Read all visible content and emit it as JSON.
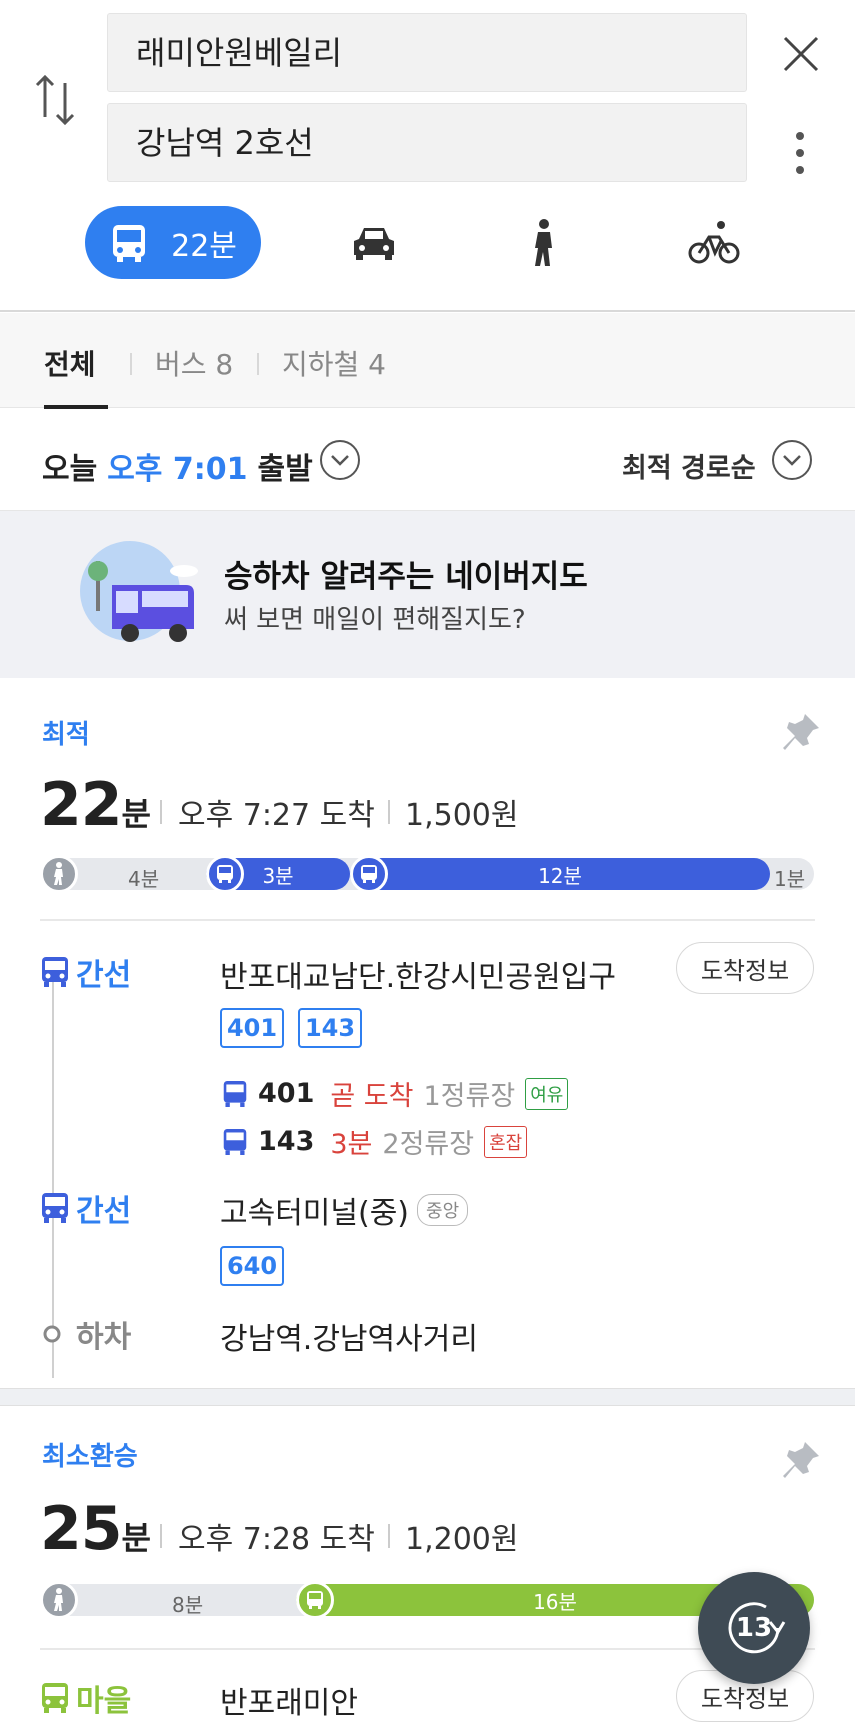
{
  "search": {
    "origin": "래미안원베일리",
    "destination": "강남역 2호선"
  },
  "modes": {
    "transit_time": "22분"
  },
  "tabs": [
    {
      "label": "전체"
    },
    {
      "label": "버스 8"
    },
    {
      "label": "지하철 4"
    }
  ],
  "departure": {
    "prefix": "오늘",
    "time": "오후 7:01",
    "suffix": "출발",
    "sort": "최적 경로순"
  },
  "banner": {
    "title": "승하차 알려주는 네이버지도",
    "subtitle": "써 보면 매일이 편해질지도?"
  },
  "route1": {
    "label": "최적",
    "minutes": "22",
    "minutes_unit": "분",
    "arrival": "오후 7:27 도착",
    "fare": "1,500원",
    "segments": {
      "walk1": "4분",
      "bus1": "3분",
      "bus2": "12분",
      "walk2": "1분"
    },
    "steps": [
      {
        "type": "간선",
        "stop": "반포대교남단.한강시민공원입구",
        "button": "도착정보",
        "routes": [
          "401",
          "143"
        ],
        "arrivals": [
          {
            "num": "401",
            "time": "곧 도착",
            "stops": "1정류장",
            "crowd": "여유"
          },
          {
            "num": "143",
            "time": "3분",
            "stops": "2정류장",
            "crowd": "혼잡"
          }
        ]
      },
      {
        "type": "간선",
        "stop": "고속터미널(중)",
        "badge": "중앙",
        "routes": [
          "640"
        ]
      },
      {
        "type": "하차",
        "stop": "강남역.강남역사거리"
      }
    ]
  },
  "route2": {
    "label": "최소환승",
    "minutes": "25",
    "minutes_unit": "분",
    "arrival": "오후 7:28 도착",
    "fare": "1,200원",
    "segments": {
      "walk1": "8분",
      "bus1": "16분"
    },
    "step": {
      "type": "마을",
      "stop": "반포래미안",
      "button": "도착정보"
    }
  },
  "fab": {
    "count": "13"
  },
  "colors": {
    "accent": "#2f7ff0",
    "bus_blue": "#3d5fdc",
    "village_green": "#8cc33c",
    "alert_red": "#d9433c"
  }
}
